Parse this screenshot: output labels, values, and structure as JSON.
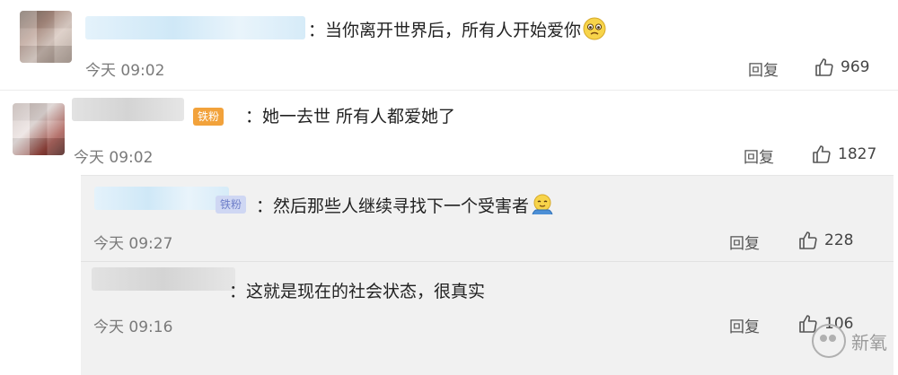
{
  "comments": [
    {
      "text": "：当你离开世界后，所有人开始爱你",
      "emoji": "crying-face-icon",
      "time": "今天 09:02",
      "reply_label": "回复",
      "likes": "969"
    },
    {
      "badge": "铁粉",
      "text": "：她一去世 所有人都爱她了",
      "time": "今天 09:02",
      "reply_label": "回复",
      "likes": "1827"
    }
  ],
  "replies": [
    {
      "badge": "铁粉",
      "text": "：然后那些人继续寻找下一个受害者",
      "emoji": "shrugging-face-icon",
      "time": "今天 09:27",
      "reply_label": "回复",
      "likes": "228"
    },
    {
      "text": "：这就是现在的社会状态，很真实",
      "time": "今天 09:16",
      "reply_label": "回复",
      "likes": "106"
    }
  ],
  "watermark": {
    "label": "新氧",
    "icon": "wechat-logo-icon"
  },
  "colors": {
    "badge": "#f2a23b",
    "reply_background": "#f1f1f1",
    "name_blur": "#cfe8f7"
  }
}
